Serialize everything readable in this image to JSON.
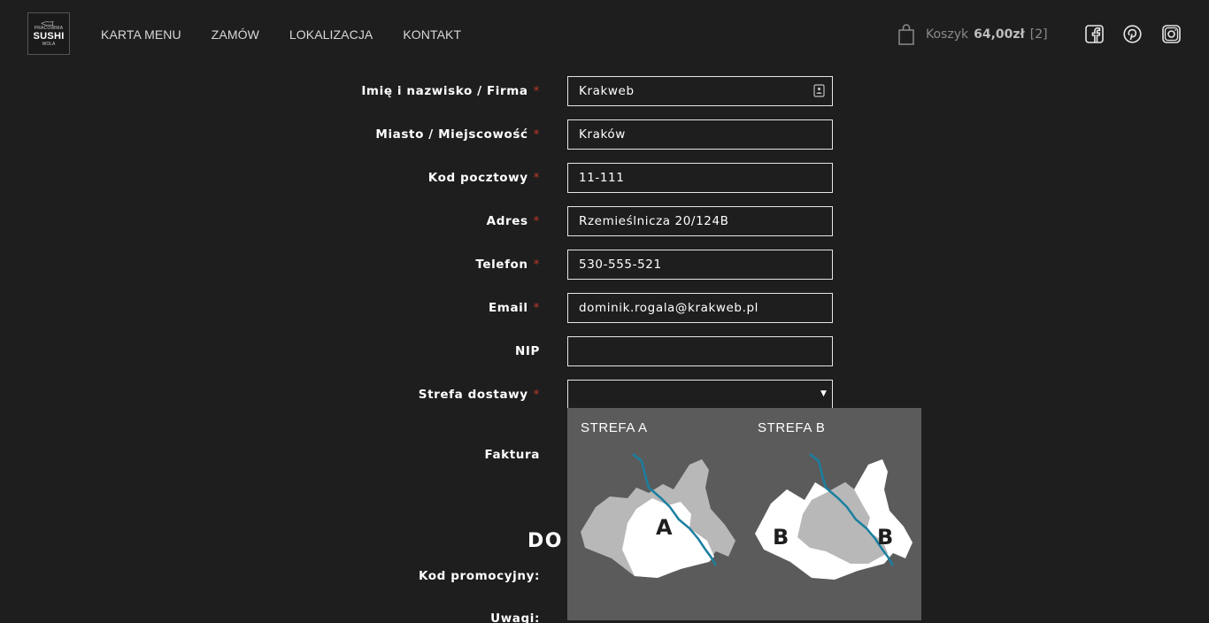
{
  "logo": {
    "line1": "PRACOWNIA",
    "line2": "SUSHI",
    "line3": "WOLA"
  },
  "nav": [
    {
      "label": "KARTA MENU"
    },
    {
      "label": "ZAMÓW"
    },
    {
      "label": "LOKALIZACJA"
    },
    {
      "label": "KONTAKT"
    }
  ],
  "cart": {
    "label": "Koszyk",
    "total": "64,00zł",
    "count": "[2]"
  },
  "social": [
    "facebook-icon",
    "pinterest-icon",
    "instagram-icon"
  ],
  "form": {
    "required_mark": "*",
    "name": {
      "label": "Imię i nazwisko / Firma",
      "value": "Krakweb"
    },
    "city": {
      "label": "Miasto / Miejscowość",
      "value": "Kraków"
    },
    "postal": {
      "label": "Kod pocztowy",
      "value": "11-111"
    },
    "address": {
      "label": "Adres",
      "value": "Rzemieślnicza 20/124B"
    },
    "phone": {
      "label": "Telefon",
      "value": "530-555-521"
    },
    "email": {
      "label": "Email",
      "value": "dominik.rogala@krakweb.pl"
    },
    "nip": {
      "label": "NIP",
      "value": ""
    },
    "zone": {
      "label": "Strefa dostawy",
      "value": ""
    },
    "invoice": {
      "label": "Faktura"
    },
    "section_heading": "DO",
    "promo": {
      "label": "Kod promocyjny:"
    },
    "notes": {
      "label": "Uwagi:"
    }
  },
  "zones": {
    "a": {
      "title": "STREFA A",
      "letter": "A"
    },
    "b": {
      "title": "STREFA B",
      "letter": "B"
    }
  },
  "colors": {
    "background": "#1e1e1e",
    "required": "#c0392b",
    "zone_panel": "#5b5b5b",
    "river": "#1a7fa0"
  }
}
